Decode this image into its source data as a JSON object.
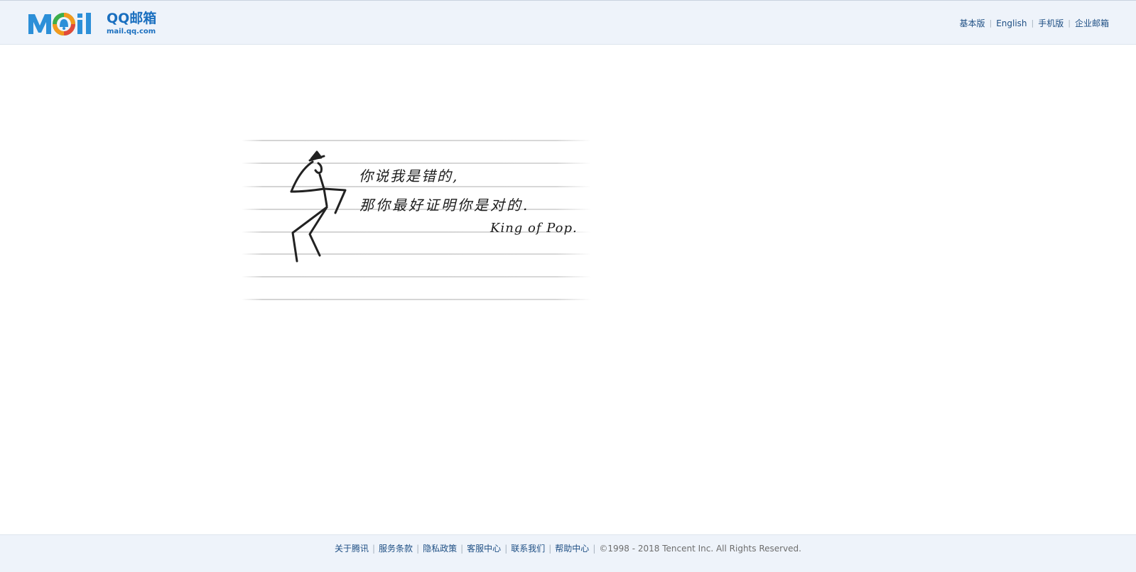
{
  "brand": {
    "logo_word": "Mail",
    "name": "QQ邮箱",
    "domain": "mail.qq.com",
    "colors": {
      "primary": "#1a6fbf",
      "accent_orange": "#f39a1d",
      "accent_red": "#e24a3b",
      "accent_green": "#3dae4a"
    }
  },
  "top_nav": {
    "items": [
      "基本版",
      "English",
      "手机版",
      "企业邮箱"
    ]
  },
  "note": {
    "lines": [
      "你说我是错的,",
      "那你最好证明你是对的.",
      "King of Pop."
    ]
  },
  "footer": {
    "links": [
      "关于腾讯",
      "服务条款",
      "隐私政策",
      "客服中心",
      "联系我们",
      "帮助中心"
    ],
    "copyright": "©1998 - 2018 Tencent Inc. All Rights Reserved."
  }
}
